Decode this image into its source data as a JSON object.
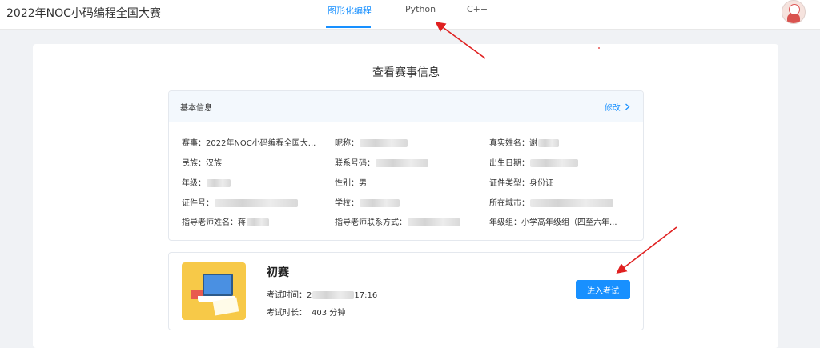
{
  "header": {
    "brand": "2022年NOC小码编程全国大赛",
    "tabs": [
      {
        "label": "图形化编程",
        "active": true
      },
      {
        "label": "Python",
        "active": false
      },
      {
        "label": "C++",
        "active": false
      }
    ]
  },
  "page": {
    "title": "查看赛事信息"
  },
  "basic_info": {
    "title": "基本信息",
    "edit_label": "修改",
    "fields": [
      {
        "label": "赛事：",
        "value": "2022年NOC小码编程全国大..."
      },
      {
        "label": "昵称：",
        "value": ""
      },
      {
        "label": "真实姓名：",
        "value": "谢"
      },
      {
        "label": "民族：",
        "value": "汉族"
      },
      {
        "label": "联系号码：",
        "value": ""
      },
      {
        "label": "出生日期：",
        "value": ""
      },
      {
        "label": "年级：",
        "value": ""
      },
      {
        "label": "性别：",
        "value": "男"
      },
      {
        "label": "证件类型：",
        "value": "身份证"
      },
      {
        "label": "证件号：",
        "value": ""
      },
      {
        "label": "学校：",
        "value": ""
      },
      {
        "label": "所在城市：",
        "value": ""
      },
      {
        "label": "指导老师姓名：",
        "value": "蒋"
      },
      {
        "label": "指导老师联系方式：",
        "value": ""
      },
      {
        "label": "年级组：",
        "value": "小学高年级组（四至六年..."
      }
    ]
  },
  "exam": {
    "title": "初赛",
    "time_label": "考试时间：",
    "time_prefix": "2",
    "time_suffix": "17:16",
    "duration_label": "考试时长：",
    "duration_value": "403 分钟",
    "enter_label": "进入考试"
  },
  "colors": {
    "accent": "#1890ff",
    "annotation": "#e02020"
  }
}
